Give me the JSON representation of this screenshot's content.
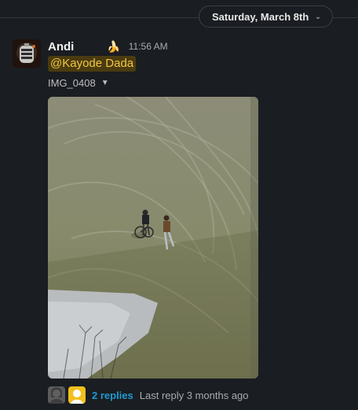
{
  "date_divider": {
    "label": "Saturday, March 8th",
    "chevron_icon": "chevron-down-icon"
  },
  "message": {
    "author": "Andi",
    "status_emoji": "🍌",
    "timestamp": "11:56 AM",
    "mention": "@Kayode Dada",
    "file": {
      "name": "IMG_0408",
      "caret_icon": "caret-down-icon"
    },
    "thread": {
      "replies_label": "2 replies",
      "last_reply": "Last reply 3 months ago"
    }
  },
  "colors": {
    "background": "#1a1d21",
    "mention_bg": "#4a3b10",
    "mention_text": "#f2c744",
    "link": "#1d9bd1"
  }
}
